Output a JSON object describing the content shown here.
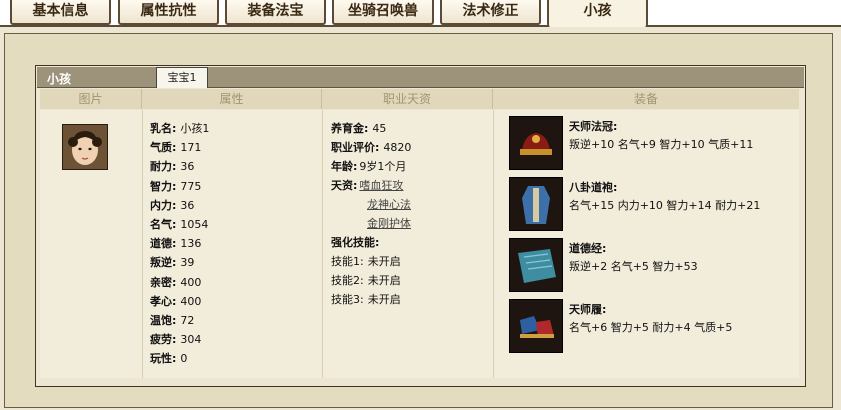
{
  "tabs": [
    "基本信息",
    "属性抗性",
    "装备法宝",
    "坐骑召唤兽",
    "法术修正",
    "小孩"
  ],
  "active_tab": "小孩",
  "panel": {
    "title": "小孩",
    "subtab": "宝宝1"
  },
  "columns": [
    "图片",
    "属性",
    "职业天资",
    "装备"
  ],
  "attributes": [
    {
      "label": "乳名:",
      "value": "小孩1"
    },
    {
      "label": "气质:",
      "value": "171"
    },
    {
      "label": "耐力:",
      "value": "36"
    },
    {
      "label": "智力:",
      "value": "775"
    },
    {
      "label": "内力:",
      "value": "36"
    },
    {
      "label": "名气:",
      "value": "1054"
    },
    {
      "label": "道德:",
      "value": "136"
    },
    {
      "label": "叛逆:",
      "value": "39"
    },
    {
      "label": "亲密:",
      "value": "400"
    },
    {
      "label": "孝心:",
      "value": "400"
    },
    {
      "label": "温饱:",
      "value": "72"
    },
    {
      "label": "疲劳:",
      "value": "304"
    },
    {
      "label": "玩性:",
      "value": "0"
    }
  ],
  "career": {
    "fund_label": "养育金:",
    "fund_value": "45",
    "rating_label": "职业评价:",
    "rating_value": "4820",
    "age_label": "年龄:",
    "age_value": "9岁1个月",
    "talent_label": "天资:",
    "talents": [
      "嗜血狂攻",
      "龙神心法",
      "金刚护体"
    ],
    "skills_label": "强化技能:",
    "skills": [
      {
        "label": "技能1:",
        "value": "未开启"
      },
      {
        "label": "技能2:",
        "value": "未开启"
      },
      {
        "label": "技能3:",
        "value": "未开启"
      }
    ]
  },
  "equipment": [
    {
      "name": "天师法冠:",
      "stats": "叛逆+10 名气+9 智力+10 气质+11",
      "icon": "hat-icon"
    },
    {
      "name": "八卦道袍:",
      "stats": "名气+15 内力+10 智力+14 耐力+21",
      "icon": "robe-icon"
    },
    {
      "name": "道德经:",
      "stats": "叛逆+2 名气+5 智力+53",
      "icon": "book-icon"
    },
    {
      "name": "天师履:",
      "stats": "名气+6 智力+5 耐力+4 气质+5",
      "icon": "shoes-icon"
    }
  ]
}
